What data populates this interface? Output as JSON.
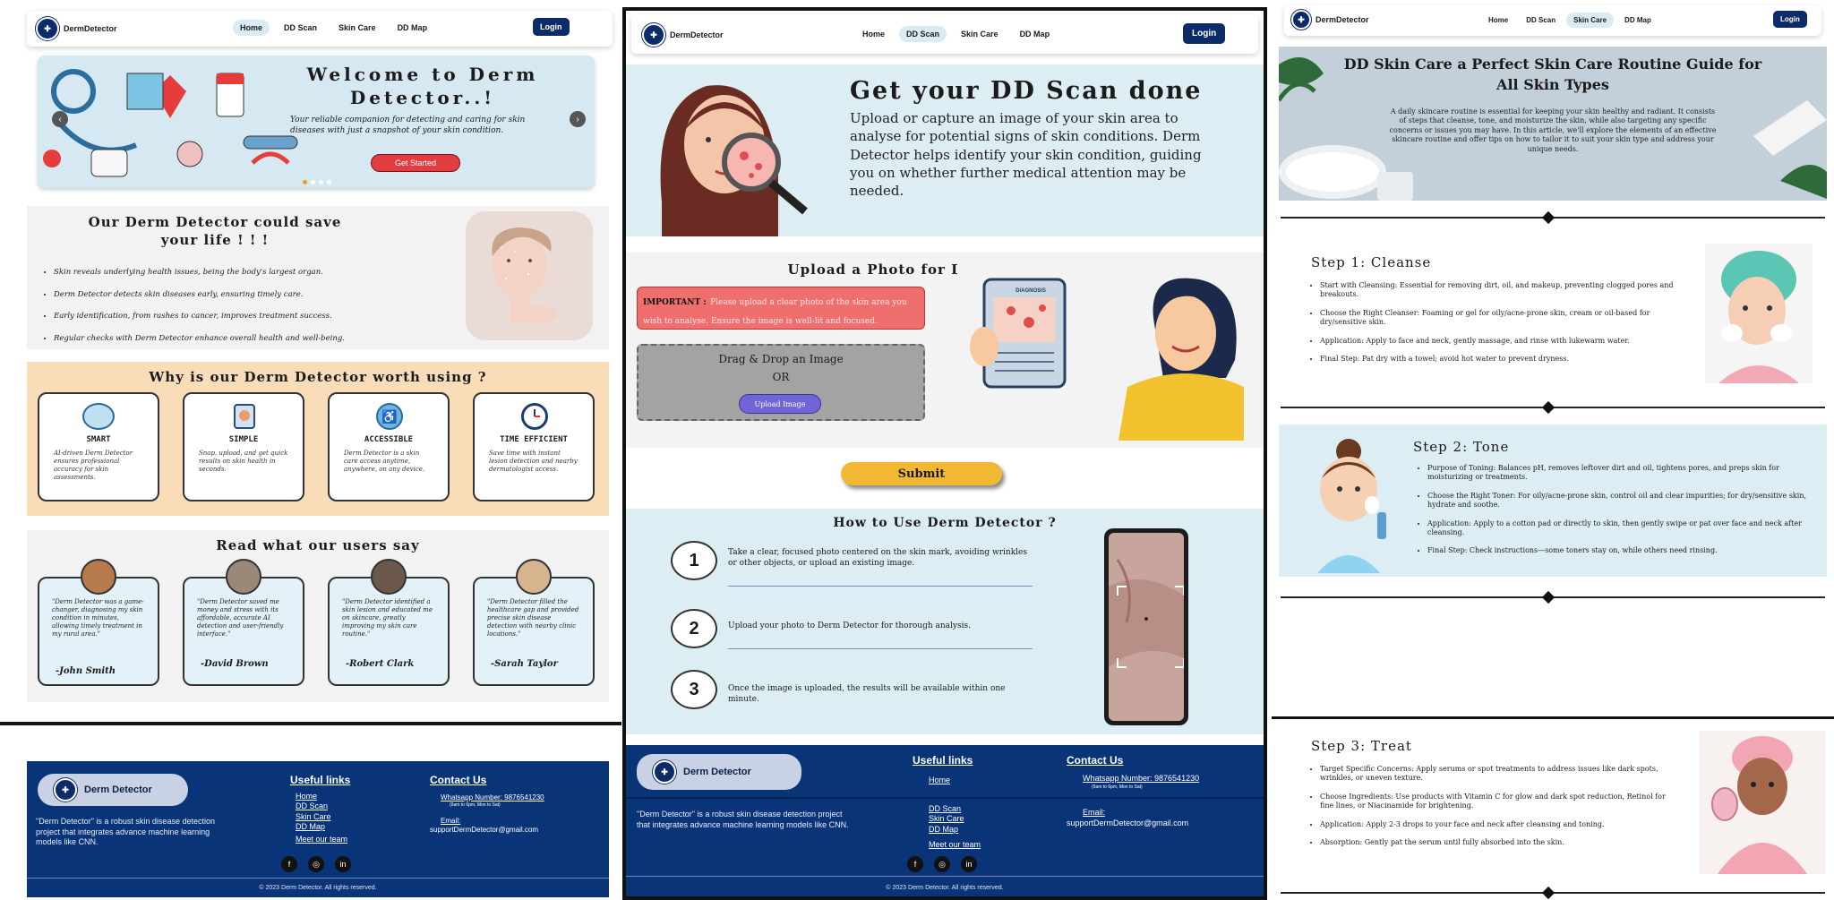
{
  "brand": "DermDetector",
  "nav": {
    "links": [
      "Home",
      "DD Scan",
      "Skin Care",
      "DD Map"
    ],
    "login": "Login"
  },
  "home": {
    "hero_title": "Welcome to Derm Detector..!",
    "hero_text": "Your reliable companion for detecting and caring for skin diseases with just a snapshot of your skin condition.",
    "hero_button": "Get Started",
    "save_title": "Our Derm Detector could save your life ! ! !",
    "save_points": [
      "Skin reveals underlying health issues, being the body's largest organ.",
      "Derm Detector detects skin diseases early, ensuring timely care.",
      "Early identification, from rashes to cancer, improves treatment success.",
      "Regular checks with Derm Detector enhance overall health and well-being."
    ],
    "worth_title": "Why is our Derm Detector worth using ?",
    "features": [
      {
        "title": "SMART",
        "text": "AI-driven Derm Detector ensures professional accuracy for skin assessments.",
        "icon": "brain-icon"
      },
      {
        "title": "SIMPLE",
        "text": "Snap, upload, and get quick results on skin health in seconds.",
        "icon": "hand-icon"
      },
      {
        "title": "ACCESSIBLE",
        "text": "Derm Detector is a skin care access anytime, anywhere, on any device.",
        "icon": "person-icon"
      },
      {
        "title": "TIME EFFICIENT",
        "text": "Save time with instant lesion detection and nearby dermatologist access.",
        "icon": "clock-icon"
      }
    ],
    "reviews_title": "Read what our users say",
    "reviews": [
      {
        "text": "\"Derm Detector was a game-changer, diagnosing my skin condition in minutes, allowing timely treatment in my rural area.\"",
        "name": "-John Smith"
      },
      {
        "text": "\"Derm Detector saved me money and stress with its affordable, accurate AI detection and user-friendly interface.\"",
        "name": "-David Brown"
      },
      {
        "text": "\"Derm Detector identified a skin lesion and educated me on skincare, greatly improving my skin care routine.\"",
        "name": "-Robert Clark"
      },
      {
        "text": "\"Derm Detector filled the healthcare gap and provided precise skin disease detection with nearby clinic locations.\"",
        "name": "-Sarah Taylor"
      }
    ]
  },
  "footer": {
    "logo": "Derm Detector",
    "desc": "\"Derm Detector\" is a robust skin disease detection project that integrates advance machine learning models like CNN.",
    "useful_title": "Useful links",
    "useful_links": [
      "Home",
      "DD Scan",
      "Skin Care",
      "DD Map"
    ],
    "meet": "Meet our team",
    "contact_title": "Contact Us",
    "whatsapp": "Whatsapp Number: 9876541230",
    "whatsapp_hours": "(9am to 6pm, Mon to Sat)",
    "email_label": "Email:",
    "email": "supportDermDetector@gmail.com",
    "copyright": "© 2023 Derm Detector. All rights reserved."
  },
  "scan": {
    "title": "Get your DD Scan done",
    "text": "Upload or capture an image of your skin area to analyse for potential signs of skin conditions. Derm Detector helps identify your skin condition, guiding you on whether further medical attention may be needed.",
    "upload_title": "Upload a Photo for Disease Detection",
    "important_label": "IMPORTANT :",
    "important_text": "Please upload a clear photo of the skin area you wish to analyse. Ensure the image is well-lit and focused.",
    "drop_text": "Drag & Drop an Image",
    "or": "OR",
    "upload_button": "Upload Image",
    "phone_label": "DIAGNOSIS",
    "submit": "Submit",
    "howto_title": "How to Use Derm Detector ?",
    "steps": [
      {
        "num": "1",
        "text": "Take a clear, focused photo centered on the skin mark, avoiding wrinkles or other objects, or upload an existing image."
      },
      {
        "num": "2",
        "text": "Upload your photo to Derm Detector for thorough analysis."
      },
      {
        "num": "3",
        "text": "Once the image is uploaded, the results will be available within one minute."
      }
    ]
  },
  "care": {
    "title": "DD Skin Care a Perfect Skin Care Routine Guide for All Skin Types",
    "intro": "A daily skincare routine is essential for keeping your skin healthy and radiant. It consists of steps that cleanse, tone, and moisturize the skin, while also targeting any specific concerns or issues you may have. In this article, we'll explore the elements of an effective skincare routine and offer tips on how to tailor it to suit your skin type and address your unique needs.",
    "steps": [
      {
        "title": "Step 1: Cleanse",
        "points": [
          "Start with Cleansing: Essential for removing dirt, oil, and makeup, preventing clogged pores and breakouts.",
          "Choose the Right Cleanser: Foaming or gel for oily/acne-prone skin, cream or oil-based for dry/sensitive skin.",
          "Application: Apply to face and neck, gently massage, and rinse with lukewarm water.",
          "Final Step: Pat dry with a towel; avoid hot water to prevent dryness."
        ]
      },
      {
        "title": "Step 2: Tone",
        "points": [
          "Purpose of Toning: Balances pH, removes leftover dirt and oil, tightens pores, and preps skin for moisturizing or treatments.",
          "Choose the Right Toner: For oily/acne-prone skin, control oil and clear impurities; for dry/sensitive skin, hydrate and soothe.",
          "Application: Apply to a cotton pad or directly to skin, then gently swipe or pat over face and neck after cleansing.",
          "Final Step: Check instructions—some toners stay on, while others need rinsing."
        ]
      },
      {
        "title": "Step 3: Treat",
        "points": [
          "Target Specific Concerns: Apply serums or spot treatments to address issues like dark spots, wrinkles, or uneven texture.",
          "Choose Ingredients: Use products with Vitamin C for glow and dark spot reduction, Retinol for fine lines, or Niacinamide for brightening.",
          "Application: Apply 2-3 drops to your face and neck after cleansing and toning.",
          "Absorption: Gently pat the serum until fully absorbed into the skin."
        ]
      }
    ]
  },
  "colors": {
    "navy": "#0a3478",
    "peach": "#f8ddb8",
    "lightblue": "#dcedf3",
    "pink": "#f0656b",
    "yellow": "#f2b833",
    "purple": "#6f64d8"
  }
}
